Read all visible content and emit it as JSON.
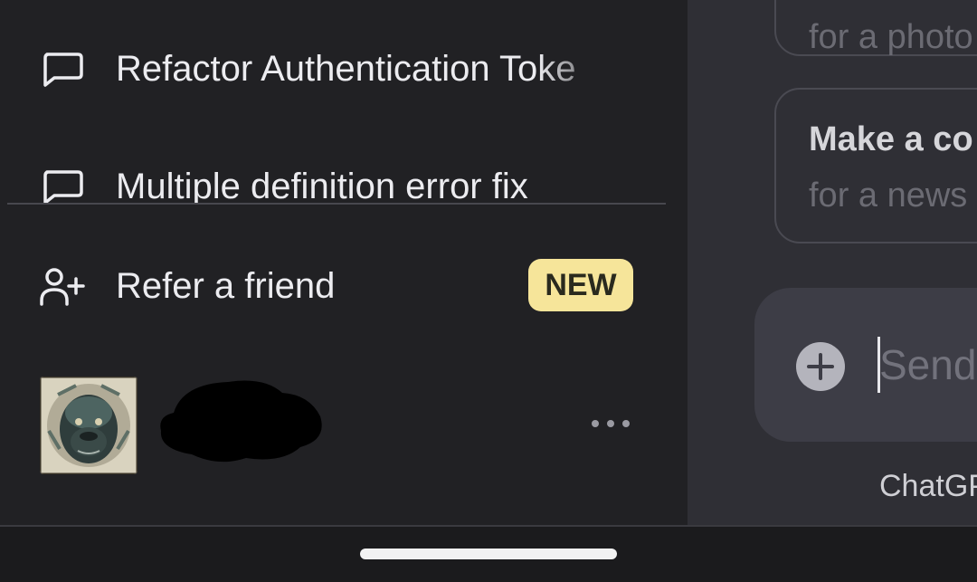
{
  "sidebar": {
    "conversations": [
      {
        "label": "Refactor Authentication Toke",
        "icon": "chat-bubble-icon"
      },
      {
        "label": "Multiple definition error fix",
        "icon": "chat-bubble-icon"
      }
    ],
    "refer": {
      "label": "Refer a friend",
      "badge": "NEW",
      "icon": "user-plus-icon"
    },
    "profile": {
      "avatar_icon": "gorilla-avatar-icon",
      "name_redacted": true,
      "more_icon": "more-dots-icon"
    }
  },
  "main": {
    "suggestions": [
      {
        "title": "",
        "subtitle": "for a photo"
      },
      {
        "title": "Make a co",
        "subtitle": "for a news"
      }
    ],
    "composer": {
      "placeholder": "Send",
      "plus_icon": "plus-circle-icon"
    },
    "footer_note": "ChatGP"
  },
  "colors": {
    "sidebar_bg": "#212124",
    "main_bg": "#2f2f35",
    "badge_bg": "#f6e59a",
    "composer_bg": "#3d3d46"
  }
}
